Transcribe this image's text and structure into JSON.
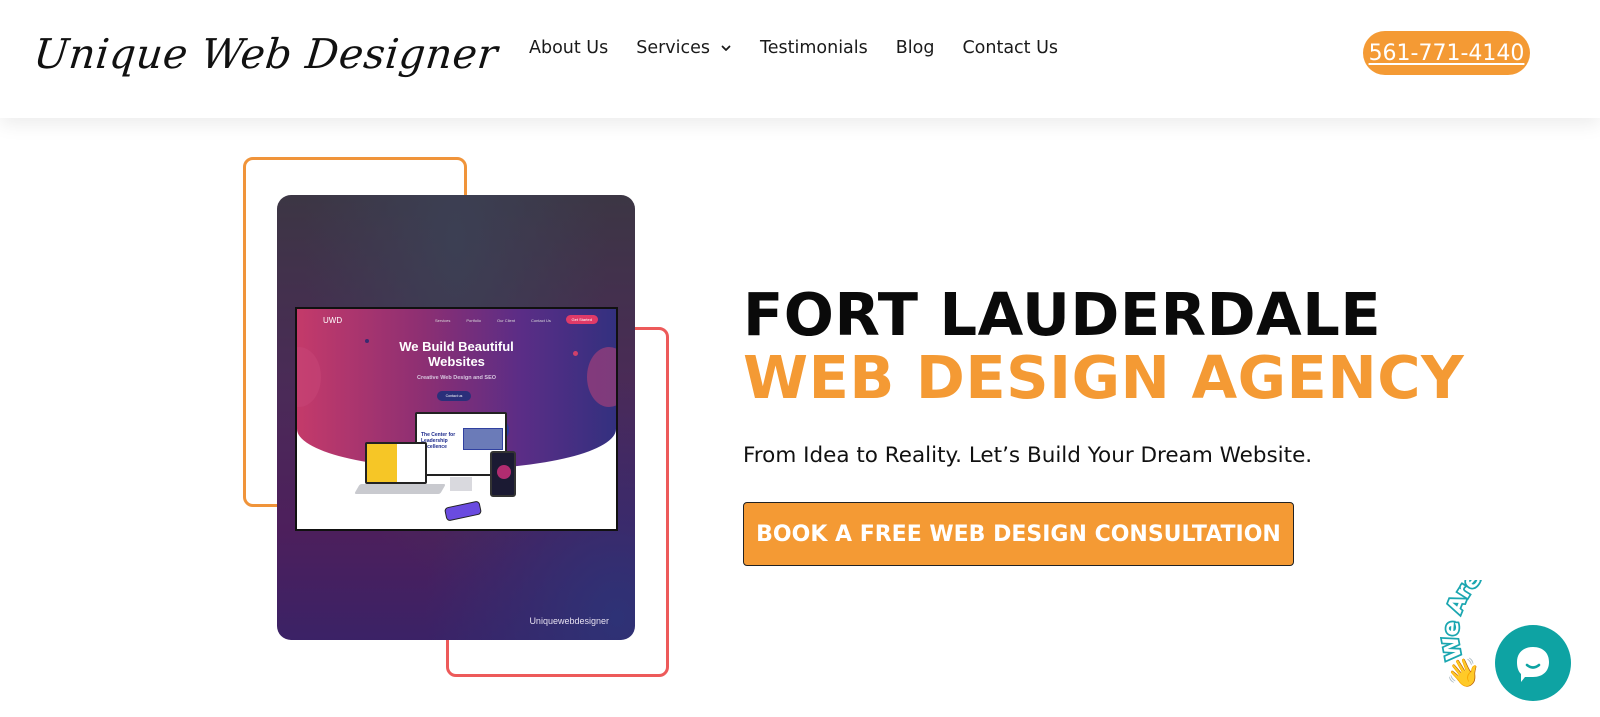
{
  "header": {
    "logo_text": "Unique Web Designer",
    "nav": [
      {
        "label": "About Us",
        "has_dropdown": false
      },
      {
        "label": "Services",
        "has_dropdown": true
      },
      {
        "label": "Testimonials",
        "has_dropdown": false
      },
      {
        "label": "Blog",
        "has_dropdown": false
      },
      {
        "label": "Contact Us",
        "has_dropdown": false
      }
    ],
    "phone": "561-771-4140"
  },
  "hero": {
    "headline_line1": "FORT LAUDERDALE",
    "headline_line2": "WEB DESIGN AGENCY",
    "tagline": "From Idea to Reality. Let’s Build Your Dream Website.",
    "cta_label": "BOOK A FREE WEB DESIGN CONSULTATION",
    "image": {
      "watermark": "Uniquewebdesigner",
      "mock_logo": "UWD",
      "mock_nav": [
        "Services",
        "Portfolio",
        "Our Client",
        "Contact Us"
      ],
      "mock_cta": "Get Started",
      "mock_title": "We Build Beautiful Websites",
      "mock_subtitle": "Creative Web Design and SEO",
      "mock_button": "Contact us",
      "monitor_text": "The Center for Leadership Excellence"
    }
  },
  "chat_widget": {
    "label": "We Are Here!",
    "icon": "chat-bubble-icon",
    "wave_icon": "waving-hand-icon"
  },
  "colors": {
    "accent_orange": "#f49a34",
    "frame_red": "#ed5a5a",
    "chat_teal": "#0ea3a3",
    "text_dark": "#0a0a0a"
  }
}
